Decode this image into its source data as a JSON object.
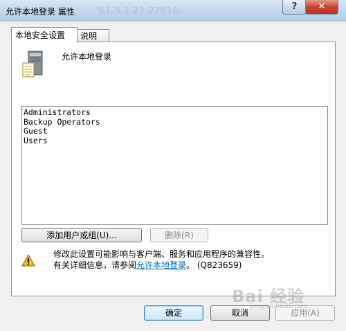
{
  "window": {
    "title": "允许本地登录 属性",
    "ghost_text": "%1.5.1.21.27016.",
    "help_glyph": "?",
    "close_glyph": "✕"
  },
  "tabs": [
    {
      "label": "本地安全设置",
      "active": true
    },
    {
      "label": "说明",
      "active": false
    }
  ],
  "policy": {
    "name": "允许本地登录",
    "icon": "server-document-icon"
  },
  "members": [
    "Administrators",
    "Backup Operators",
    "Guest",
    "Users"
  ],
  "buttons": {
    "add": "添加用户或组(U)...",
    "remove": "删除(R)"
  },
  "warning": {
    "icon": "warning-icon",
    "line1": "修改此设置可能影响与客户端、服务和应用程序的兼容性。",
    "line2_prefix": "有关详细信息，请参阅",
    "link": "允许本地登录",
    "line2_suffix": "。 (Q823659)"
  },
  "footer": {
    "ok": "确定",
    "cancel": "取消",
    "apply": "应用(A)"
  },
  "watermark": {
    "main": "Bai 经验",
    "sub": "jingyan.baidu.com"
  },
  "colors": {
    "titlebar": "#c5d8ec",
    "close_button": "#c7452f",
    "link": "#0066cc",
    "warning": "#f2c200"
  }
}
